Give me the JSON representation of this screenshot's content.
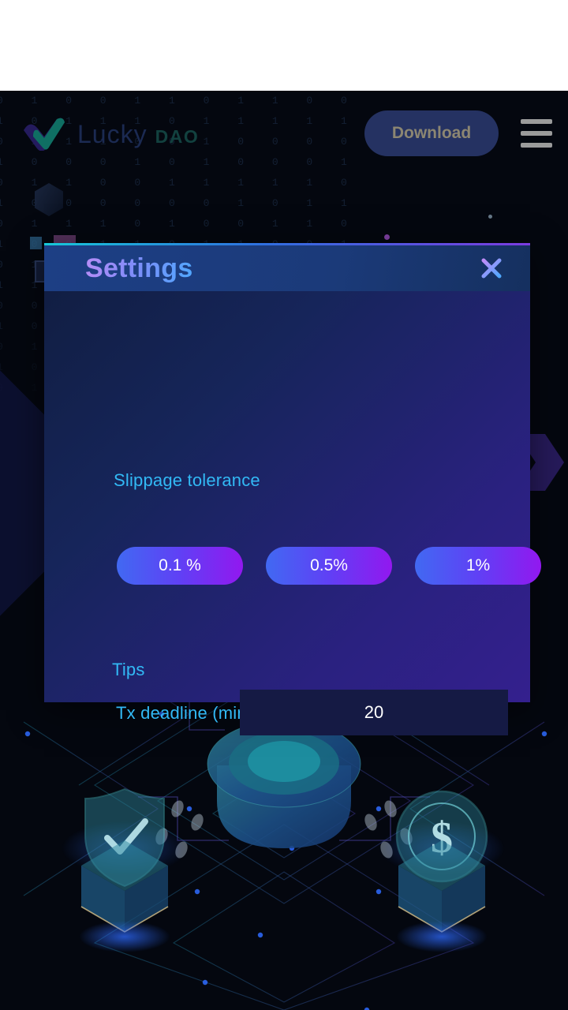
{
  "header": {
    "brand_main": "Lucky",
    "brand_sub": "DAO",
    "logo_icon": "check-mark-icon",
    "download_label": "Download",
    "menu_icon": "hamburger-menu-icon"
  },
  "page": {
    "heading": "Settings",
    "binary_text": "0 1 0 0 1 1 0 1 1 0 0 0 1 1 1 1 1 0 0 1 0 1 1\n1 0 1 1 1 0 1 1 1 1 1 1 0 0 0 1 1 0 1 1 0 0 1\n0 1 1 1 0 0 1 0 0 0 0 1 0 0 1 1 0 0 1 0 1 1 1\n1 0 0 0 1 0 1 0 0 0 1 0 1 0 1 0 0 1 1 1 0 0 0\n0 1 1 0 0 1 1 1 1 1 0 0 0 0 1 0 1 1 0 0 0 1 1\n1 0 0 0 0 0 0 1 0 1 1 1 0 1 0 1 0 0 0 1 0 0 0\n0 1 1 1 0 1 0 0 1 1 0 1 1 0 1 0 1 1 1 0 0 1 0\n1 0 0 1 1 0 1 1 0 0 1 0 1 1 0 0 1 0 0 1 1 0 1\n0 1 0 1 0 0 0 1 1 1 0 1 0 1 1 0 1 0 0 1 0 1 0\n1 1 0 0 1 1 0 1 0 0 1 1 0 0 1 0 0 1 1 0 1 1 0\n0 0 1 1 0 1 1 0 1 1 0 0 0 1 0 1 1 0 1 0 0 0 1\n1 0 1 0 1 0 0 1 0 1 1 0 1 0 0 1 0 1 0 1 1 0 0\n0 1 1 0 0 1 1 0 0 1 0 1 1 1 0 0 1 1 0 0 1 0 1\n1 0 0 1 1 0 0 1 1 0 1 0 0 0 1 1 0 0 1 1 0 1 0\n0 1 0 1 0 1 1 0 1 0 0 1 0 1 1 0 1 0 1 0 0 1 1",
    "illustration": "isometric-blockchain-illustration",
    "illustration_icons": [
      "shield-check-icon",
      "dollar-coin-icon",
      "glow-cube-icon",
      "network-lines"
    ]
  },
  "modal": {
    "title": "Settings",
    "close_icon": "close-x-icon",
    "slippage": {
      "label": "Slippage tolerance",
      "options": [
        "0.1 %",
        "0.5%",
        "1%"
      ]
    },
    "tips": {
      "label": "Tips",
      "deadline_label": "Tx deadline (mins)",
      "deadline_value": "20",
      "deadline_placeholder": "20"
    }
  },
  "colors": {
    "accent_cyan": "#32b9f5",
    "gradient_blue": "#4169f2",
    "gradient_purple": "#9218ef",
    "modal_header": "#1d3f85",
    "page_bg": "#04070f"
  }
}
